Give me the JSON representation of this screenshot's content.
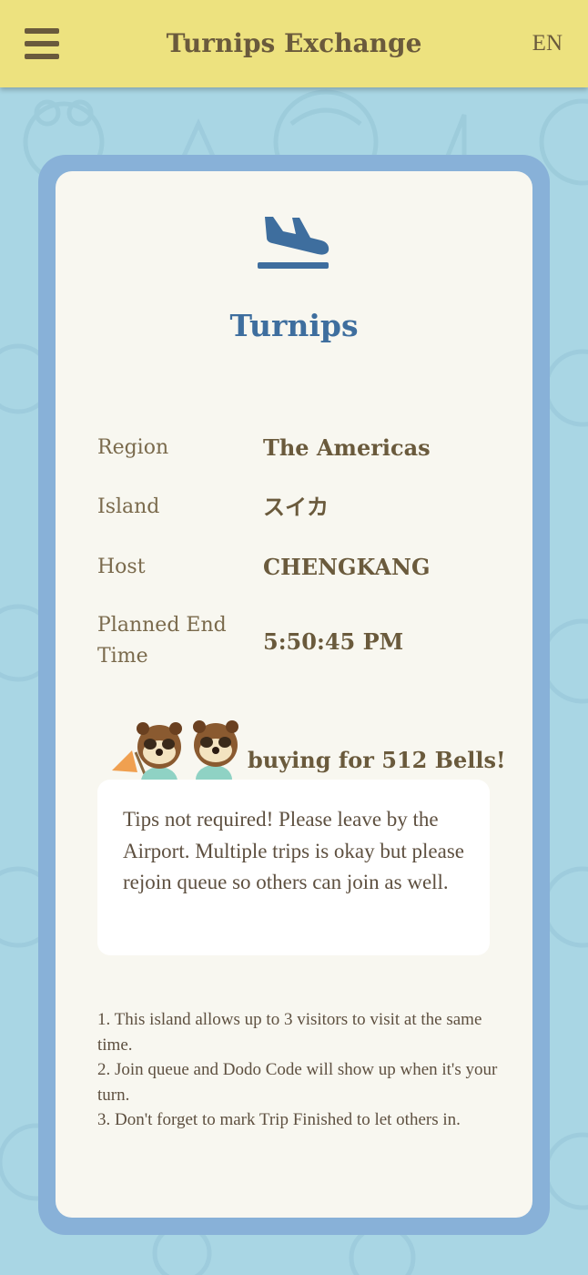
{
  "header": {
    "title": "Turnips Exchange",
    "language": "EN"
  },
  "card": {
    "title": "Turnips",
    "info": [
      {
        "label": "Region",
        "value": "The Americas"
      },
      {
        "label": "Island",
        "value": "スイカ"
      },
      {
        "label": "Host",
        "value": "CHENGKANG"
      },
      {
        "label": "Planned End Time",
        "value": "5:50:45 PM"
      }
    ],
    "buying_text": "buying for 512 Bells!",
    "note": "Tips not required! Please leave by the Airport. Multiple trips is okay but please rejoin queue so others can join as well.",
    "rules": [
      "1. This island allows up to 3 visitors to visit at the same time.",
      "2. Join queue and Dodo Code will show up when it's your turn.",
      "3. Don't forget to mark Trip Finished to let others in."
    ]
  },
  "colors": {
    "header_bg": "#ede27f",
    "page_bg": "#a9d6e4",
    "card_frame": "#88b1d8",
    "card_bg": "#f8f7f0",
    "title_blue": "#3e6e9e",
    "text_brown": "#6a5a3c"
  },
  "icons": {
    "menu": "hamburger-menu-icon",
    "plane": "airplane-landing-icon",
    "characters": "tanuki-brothers-icon"
  }
}
